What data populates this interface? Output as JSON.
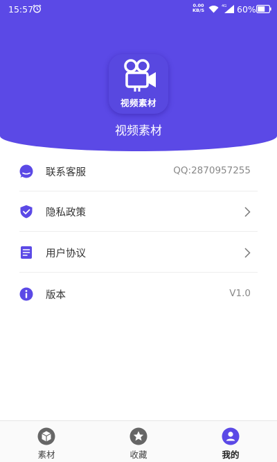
{
  "status_bar": {
    "time": "15:57",
    "net_speed_value": "0.00",
    "net_speed_unit": "KB/S",
    "network_type": "4G",
    "battery": "60%"
  },
  "header": {
    "logo_text": "视频素材",
    "app_name": "视频素材",
    "background_color": "#5b49e6"
  },
  "menu": {
    "items": [
      {
        "label": "联系客服",
        "value": "QQ:2870957255",
        "icon": "chat-bubble-icon"
      },
      {
        "label": "隐私政策",
        "value": "",
        "icon": "shield-check-icon"
      },
      {
        "label": "用户协议",
        "value": "",
        "icon": "document-icon"
      },
      {
        "label": "版本",
        "value": "V1.0",
        "icon": "info-icon"
      }
    ],
    "icon_color": "#5b49e6"
  },
  "bottom_nav": {
    "items": [
      {
        "label": "素材",
        "icon": "cube-icon",
        "active": false
      },
      {
        "label": "收藏",
        "icon": "star-icon",
        "active": false
      },
      {
        "label": "我的",
        "icon": "user-icon",
        "active": true
      }
    ],
    "active_color": "#5b49e6",
    "inactive_color": "#666666"
  }
}
